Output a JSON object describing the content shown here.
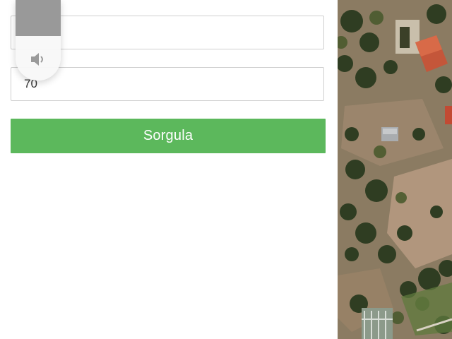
{
  "form": {
    "field1": {
      "value": "",
      "placeholder": ""
    },
    "field2": {
      "value": "70",
      "placeholder": ""
    },
    "submit_label": "Sorgula",
    "accent_color": "#5cb85c"
  },
  "volume_overlay": {
    "level": 0.45,
    "icon": "speaker-icon"
  },
  "map": {
    "type": "satellite"
  }
}
